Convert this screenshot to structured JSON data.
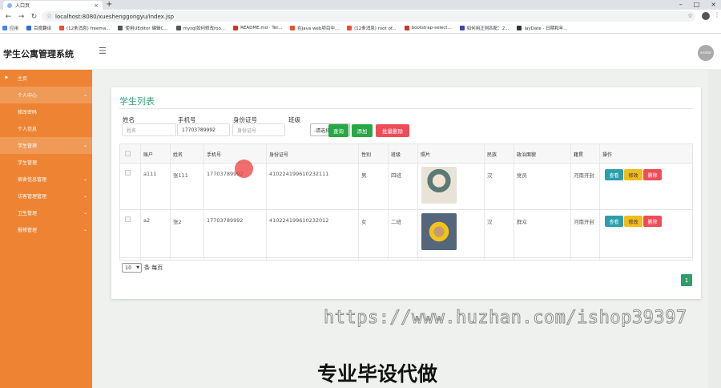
{
  "browser": {
    "tab_title": "入口页",
    "url": "localhost:8080/xueshenggongyu/index.jsp",
    "bookmarks": [
      {
        "label": "应用",
        "color": "#4285f4"
      },
      {
        "label": "百度翻译",
        "color": "#2b6de6"
      },
      {
        "label": "(12条消息) freema...",
        "color": "#e8502f"
      },
      {
        "label": "使用UEditor 编辑C...",
        "color": "#555555"
      },
      {
        "label": "mysql如何修改roo...",
        "color": "#555555"
      },
      {
        "label": "README.md · Ter...",
        "color": "#d93025"
      },
      {
        "label": "在java web项目中...",
        "color": "#e8502f"
      },
      {
        "label": "(12条消息) root of...",
        "color": "#e8502f"
      },
      {
        "label": "bootstrap-select...",
        "color": "#c0392b"
      },
      {
        "label": "如何用正则匹配：2...",
        "color": "#3949ab"
      },
      {
        "label": "layDate - 日期和年...",
        "color": "#333333"
      }
    ]
  },
  "header": {
    "brand": "学生公寓管理系统",
    "avatar_text": "avatar"
  },
  "sidebar": {
    "items": [
      {
        "label": "主页",
        "has_arrow": false,
        "active": false,
        "flag": true
      },
      {
        "label": "个人中心",
        "has_arrow": true,
        "active": true
      },
      {
        "label": "修改密码",
        "has_arrow": false,
        "active": false
      },
      {
        "label": "个人信息",
        "has_arrow": false,
        "active": false
      },
      {
        "label": "学生管理",
        "has_arrow": true,
        "active": true
      },
      {
        "label": "学生管理",
        "has_arrow": false,
        "active": false
      },
      {
        "label": "宿舍信息管理",
        "has_arrow": true,
        "active": false
      },
      {
        "label": "访客管理管理",
        "has_arrow": true,
        "active": false
      },
      {
        "label": "卫生管理",
        "has_arrow": true,
        "active": false
      },
      {
        "label": "报修管理",
        "has_arrow": true,
        "active": false
      }
    ]
  },
  "main": {
    "title": "学生列表",
    "filters": {
      "name_label": "姓名",
      "name_placeholder": "姓名",
      "phone_label": "手机号",
      "phone_value": "17703789992",
      "id_label": "身份证号",
      "id_placeholder": "身份证号",
      "class_label": "班级",
      "class_selected": "-请选择-"
    },
    "buttons": {
      "search": "查询",
      "add": "添加",
      "batch_delete": "批量删除"
    },
    "table": {
      "headers": [
        "账户",
        "姓名",
        "手机号",
        "身份证号",
        "性别",
        "班级",
        "照片",
        "民族",
        "政治面貌",
        "籍贯",
        "操作"
      ],
      "rows": [
        {
          "account": "a111",
          "name": "张111",
          "phone": "17703789992",
          "id_card": "410224199610232111",
          "gender": "男",
          "class": "四班",
          "ethnicity": "汉",
          "political": "党员",
          "hometown": "河南开封"
        },
        {
          "account": "a2",
          "name": "张2",
          "phone": "17703789992",
          "id_card": "410224199610232012",
          "gender": "女",
          "class": "二班",
          "ethnicity": "汉",
          "political": "群众",
          "hometown": "河南开封"
        }
      ],
      "actions": {
        "view": "查看",
        "edit": "修改",
        "delete": "删除"
      }
    },
    "pager": {
      "page_size": "10",
      "per_page_text": "条 每页",
      "current_page": "1"
    }
  },
  "overlay": {
    "watermark_url": "https://www.huzhan.com/ishop39397",
    "watermark_text": "专业毕设代做"
  }
}
